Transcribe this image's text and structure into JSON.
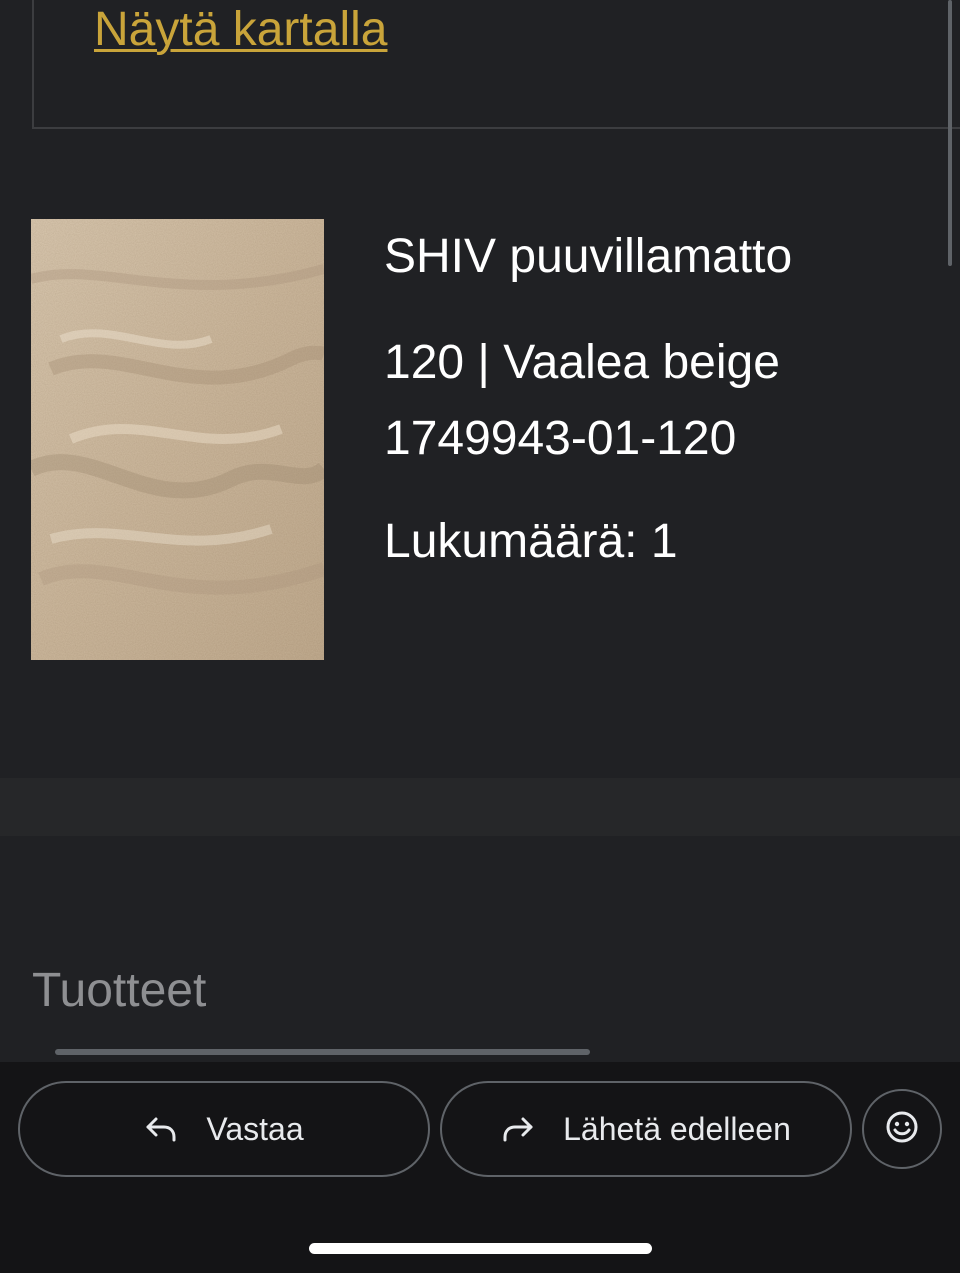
{
  "store": {
    "map_link": "Näytä kartalla"
  },
  "product": {
    "name": "SHIV puuvillamatto",
    "variant": "120 | Vaalea beige",
    "sku": "1749943-01-120",
    "quantity": "Lukumäärä: 1",
    "image_icon": "beige-cotton-rug-photo"
  },
  "section": {
    "heading": "Tuotteet"
  },
  "actions": {
    "reply_label": "Vastaa",
    "reply_icon": "reply-arrow-icon",
    "forward_label": "Lähetä edelleen",
    "forward_icon": "forward-arrow-icon",
    "emoji_icon": "smiley-icon"
  },
  "colors": {
    "background": "#202124",
    "link": "#c9a43a",
    "action_bar": "#141416",
    "muted_text": "#8e8f92"
  }
}
